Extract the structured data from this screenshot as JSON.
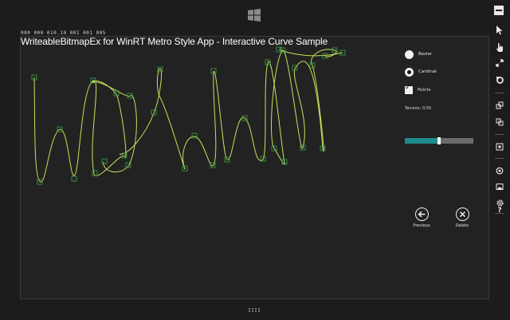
{
  "app": {
    "debug_counters": "000 000 010.10 001 001 005",
    "title": "WriteableBitmapEx for WinRT Metro Style App - Interactive Curve Sample"
  },
  "options": {
    "bezier_label": "Bezier",
    "cardinal_label": "Cardinal",
    "points_label": "Points",
    "selected_curve": "Cardinal",
    "points_checked": true,
    "tension_label": "Tension: 0,50",
    "tension_value": 0.5
  },
  "buttons": {
    "previous_label": "Previous",
    "delete_label": "Delete"
  },
  "simulator_toolbar": {
    "items": [
      "minimize-icon",
      "pointer-icon",
      "touch-icon",
      "pinch-zoom-icon",
      "rotate-icon",
      "rotate-clockwise-icon",
      "rotate-counterclockwise-icon",
      "change-resolution-icon",
      "set-location-icon",
      "screenshot-icon",
      "settings-icon",
      "help-icon"
    ]
  },
  "colors": {
    "curve": "#c8e05a",
    "point_box": "#3fa34a",
    "accent": "#1e8c8c",
    "background": "#222222"
  }
}
